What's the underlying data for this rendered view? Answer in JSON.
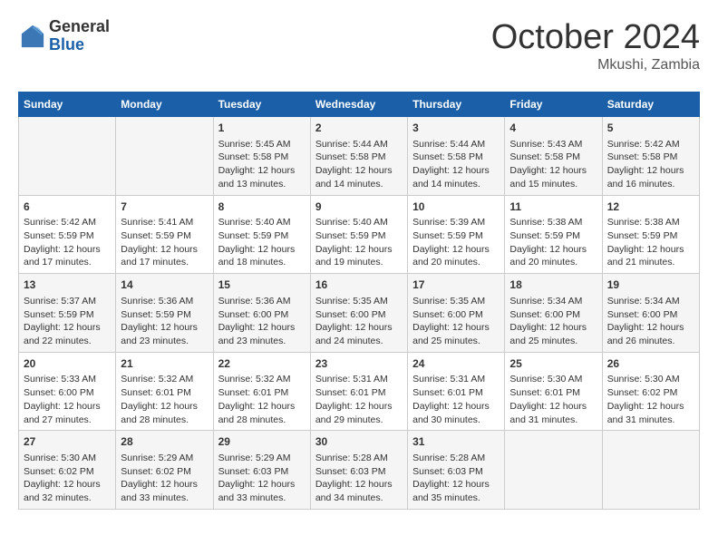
{
  "logo": {
    "general": "General",
    "blue": "Blue"
  },
  "title": "October 2024",
  "location": "Mkushi, Zambia",
  "days_of_week": [
    "Sunday",
    "Monday",
    "Tuesday",
    "Wednesday",
    "Thursday",
    "Friday",
    "Saturday"
  ],
  "weeks": [
    [
      {
        "day": "",
        "content": ""
      },
      {
        "day": "",
        "content": ""
      },
      {
        "day": "1",
        "content": "Sunrise: 5:45 AM\nSunset: 5:58 PM\nDaylight: 12 hours\nand 13 minutes."
      },
      {
        "day": "2",
        "content": "Sunrise: 5:44 AM\nSunset: 5:58 PM\nDaylight: 12 hours\nand 14 minutes."
      },
      {
        "day": "3",
        "content": "Sunrise: 5:44 AM\nSunset: 5:58 PM\nDaylight: 12 hours\nand 14 minutes."
      },
      {
        "day": "4",
        "content": "Sunrise: 5:43 AM\nSunset: 5:58 PM\nDaylight: 12 hours\nand 15 minutes."
      },
      {
        "day": "5",
        "content": "Sunrise: 5:42 AM\nSunset: 5:58 PM\nDaylight: 12 hours\nand 16 minutes."
      }
    ],
    [
      {
        "day": "6",
        "content": "Sunrise: 5:42 AM\nSunset: 5:59 PM\nDaylight: 12 hours\nand 17 minutes."
      },
      {
        "day": "7",
        "content": "Sunrise: 5:41 AM\nSunset: 5:59 PM\nDaylight: 12 hours\nand 17 minutes."
      },
      {
        "day": "8",
        "content": "Sunrise: 5:40 AM\nSunset: 5:59 PM\nDaylight: 12 hours\nand 18 minutes."
      },
      {
        "day": "9",
        "content": "Sunrise: 5:40 AM\nSunset: 5:59 PM\nDaylight: 12 hours\nand 19 minutes."
      },
      {
        "day": "10",
        "content": "Sunrise: 5:39 AM\nSunset: 5:59 PM\nDaylight: 12 hours\nand 20 minutes."
      },
      {
        "day": "11",
        "content": "Sunrise: 5:38 AM\nSunset: 5:59 PM\nDaylight: 12 hours\nand 20 minutes."
      },
      {
        "day": "12",
        "content": "Sunrise: 5:38 AM\nSunset: 5:59 PM\nDaylight: 12 hours\nand 21 minutes."
      }
    ],
    [
      {
        "day": "13",
        "content": "Sunrise: 5:37 AM\nSunset: 5:59 PM\nDaylight: 12 hours\nand 22 minutes."
      },
      {
        "day": "14",
        "content": "Sunrise: 5:36 AM\nSunset: 5:59 PM\nDaylight: 12 hours\nand 23 minutes."
      },
      {
        "day": "15",
        "content": "Sunrise: 5:36 AM\nSunset: 6:00 PM\nDaylight: 12 hours\nand 23 minutes."
      },
      {
        "day": "16",
        "content": "Sunrise: 5:35 AM\nSunset: 6:00 PM\nDaylight: 12 hours\nand 24 minutes."
      },
      {
        "day": "17",
        "content": "Sunrise: 5:35 AM\nSunset: 6:00 PM\nDaylight: 12 hours\nand 25 minutes."
      },
      {
        "day": "18",
        "content": "Sunrise: 5:34 AM\nSunset: 6:00 PM\nDaylight: 12 hours\nand 25 minutes."
      },
      {
        "day": "19",
        "content": "Sunrise: 5:34 AM\nSunset: 6:00 PM\nDaylight: 12 hours\nand 26 minutes."
      }
    ],
    [
      {
        "day": "20",
        "content": "Sunrise: 5:33 AM\nSunset: 6:00 PM\nDaylight: 12 hours\nand 27 minutes."
      },
      {
        "day": "21",
        "content": "Sunrise: 5:32 AM\nSunset: 6:01 PM\nDaylight: 12 hours\nand 28 minutes."
      },
      {
        "day": "22",
        "content": "Sunrise: 5:32 AM\nSunset: 6:01 PM\nDaylight: 12 hours\nand 28 minutes."
      },
      {
        "day": "23",
        "content": "Sunrise: 5:31 AM\nSunset: 6:01 PM\nDaylight: 12 hours\nand 29 minutes."
      },
      {
        "day": "24",
        "content": "Sunrise: 5:31 AM\nSunset: 6:01 PM\nDaylight: 12 hours\nand 30 minutes."
      },
      {
        "day": "25",
        "content": "Sunrise: 5:30 AM\nSunset: 6:01 PM\nDaylight: 12 hours\nand 31 minutes."
      },
      {
        "day": "26",
        "content": "Sunrise: 5:30 AM\nSunset: 6:02 PM\nDaylight: 12 hours\nand 31 minutes."
      }
    ],
    [
      {
        "day": "27",
        "content": "Sunrise: 5:30 AM\nSunset: 6:02 PM\nDaylight: 12 hours\nand 32 minutes."
      },
      {
        "day": "28",
        "content": "Sunrise: 5:29 AM\nSunset: 6:02 PM\nDaylight: 12 hours\nand 33 minutes."
      },
      {
        "day": "29",
        "content": "Sunrise: 5:29 AM\nSunset: 6:03 PM\nDaylight: 12 hours\nand 33 minutes."
      },
      {
        "day": "30",
        "content": "Sunrise: 5:28 AM\nSunset: 6:03 PM\nDaylight: 12 hours\nand 34 minutes."
      },
      {
        "day": "31",
        "content": "Sunrise: 5:28 AM\nSunset: 6:03 PM\nDaylight: 12 hours\nand 35 minutes."
      },
      {
        "day": "",
        "content": ""
      },
      {
        "day": "",
        "content": ""
      }
    ]
  ]
}
